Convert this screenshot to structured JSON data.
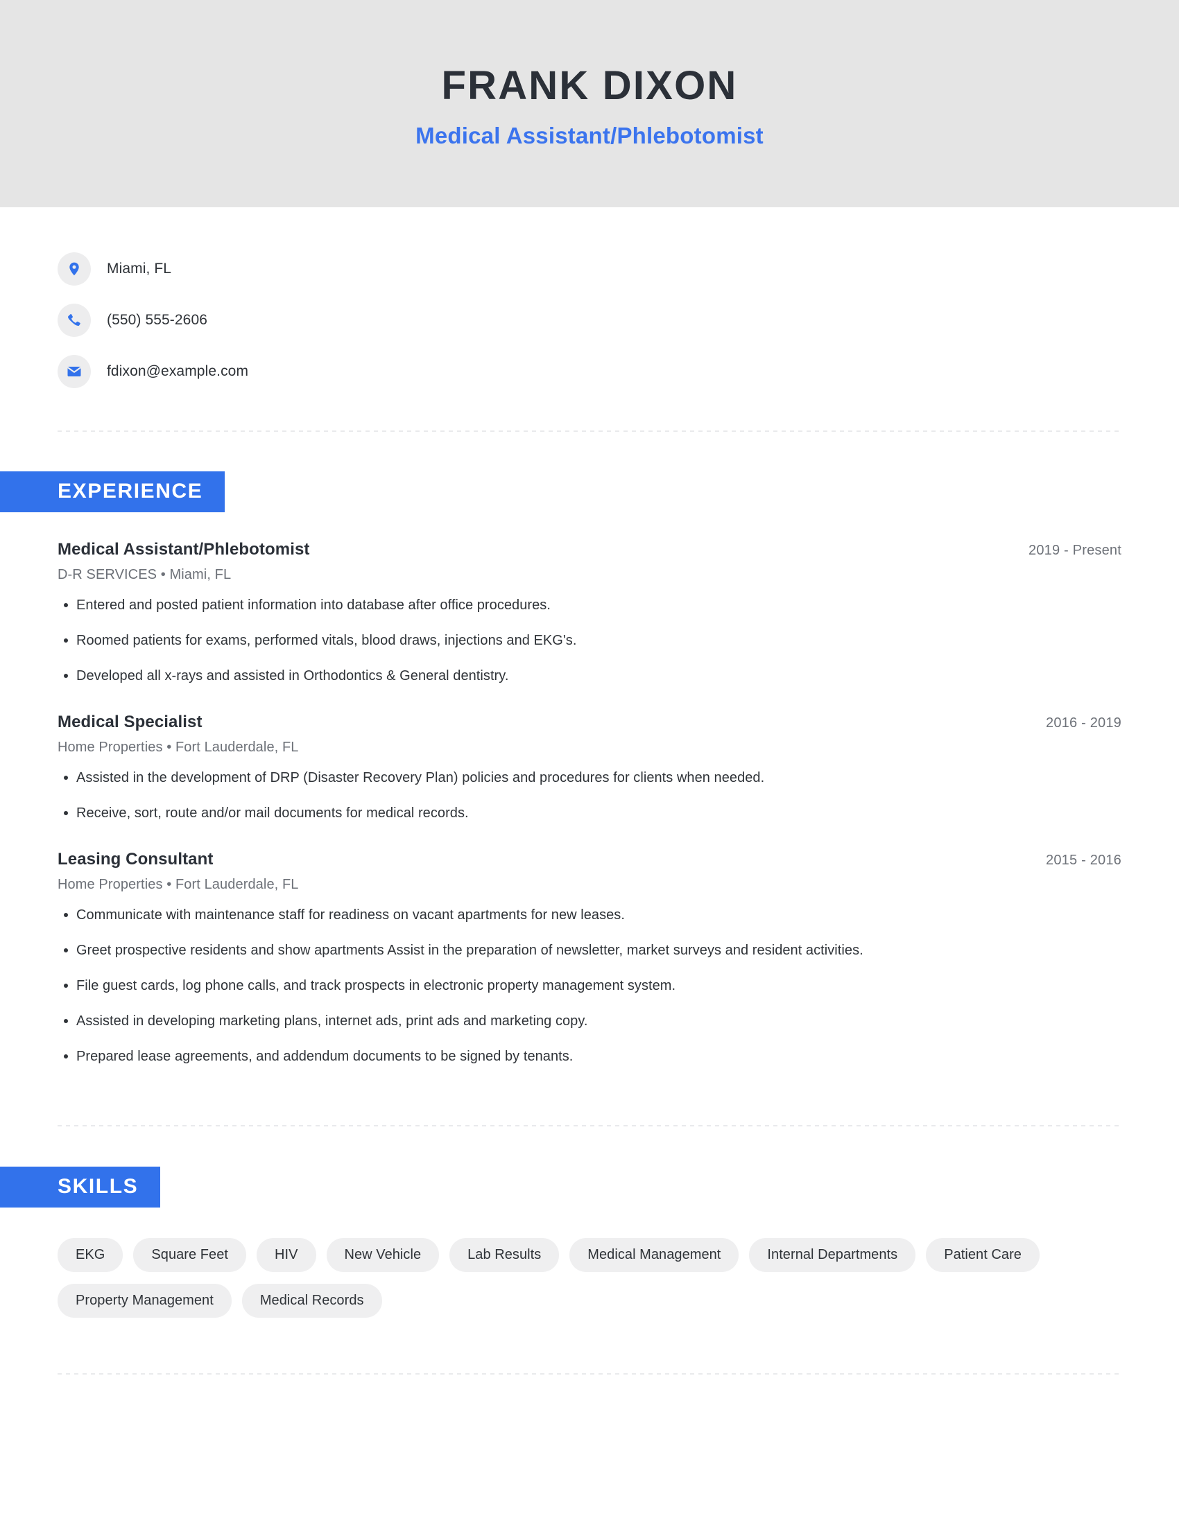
{
  "theme": {
    "header_bg": "#e5e5e5",
    "accent_blue": "#3272eb",
    "subtitle_blue": "#3b74ee",
    "text_dark": "#2b3038",
    "text_muted": "#6d7178",
    "pill_bg": "#efeff0"
  },
  "header": {
    "name": "FRANK DIXON",
    "title": "Medical Assistant/Phlebotomist"
  },
  "contact": [
    {
      "icon": "location-pin-icon",
      "value": "Miami, FL"
    },
    {
      "icon": "phone-icon",
      "value": "(550) 555-2606"
    },
    {
      "icon": "email-icon",
      "value": "fdixon@example.com"
    }
  ],
  "experience": {
    "heading": "EXPERIENCE",
    "jobs": [
      {
        "role": "Medical Assistant/Phlebotomist",
        "dates": "2019 - Present",
        "company": "D-R SERVICES",
        "separator": "•",
        "location": "Miami, FL",
        "meta": "D-R SERVICES  •  Miami, FL",
        "bullets": [
          "Entered and posted patient information into database after office procedures.",
          "Roomed patients for exams, performed vitals, blood draws, injections and EKG's.",
          "Developed all x-rays and assisted in Orthodontics & General dentistry."
        ]
      },
      {
        "role": "Medical Specialist",
        "dates": "2016 - 2019",
        "company": "Home Properties",
        "separator": "•",
        "location": "Fort Lauderdale, FL",
        "meta": "Home Properties  •  Fort Lauderdale, FL",
        "bullets": [
          "Assisted in the development of DRP (Disaster Recovery Plan) policies and procedures for clients when needed.",
          "Receive, sort, route and/or mail documents for medical records."
        ]
      },
      {
        "role": "Leasing Consultant",
        "dates": "2015 - 2016",
        "company": "Home Properties",
        "separator": "•",
        "location": "Fort Lauderdale, FL",
        "meta": "Home Properties  •  Fort Lauderdale, FL",
        "bullets": [
          "Communicate with maintenance staff for readiness on vacant apartments for new leases.",
          "Greet prospective residents and show apartments Assist in the preparation of newsletter, market surveys and resident activities.",
          "File guest cards, log phone calls, and track prospects in electronic property management system.",
          "Assisted in developing marketing plans, internet ads, print ads and marketing copy.",
          "Prepared lease agreements, and addendum documents to be signed by tenants."
        ]
      }
    ]
  },
  "skills": {
    "heading": "SKILLS",
    "items": [
      "EKG",
      "Square Feet",
      "HIV",
      "New Vehicle",
      "Lab Results",
      "Medical Management",
      "Internal Departments",
      "Patient Care",
      "Property Management",
      "Medical Records"
    ]
  }
}
